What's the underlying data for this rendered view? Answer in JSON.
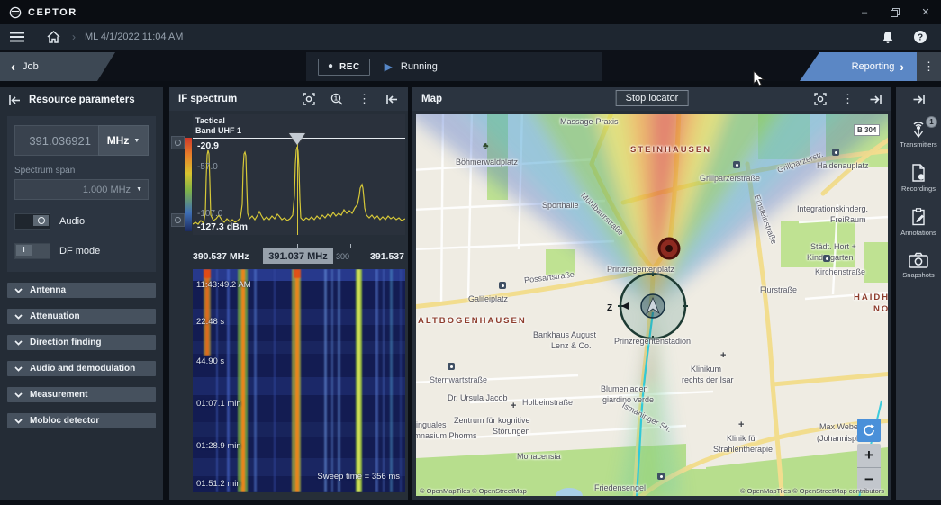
{
  "window": {
    "brand": "CEPTOR"
  },
  "icons": {
    "kebab": "⋮",
    "chevron_left": "‹",
    "chevron_right": "›",
    "breadcrumb_sep": "›",
    "dropdown": "▼",
    "rec_dot": "●",
    "play": "▶",
    "minimize": "–",
    "close": "✕",
    "help": "?",
    "df_knob": "I",
    "zoom_in": "+",
    "zoom_out": "−",
    "tree": "♣",
    "cross": "+"
  },
  "nav": {
    "breadcrumb": "ML 4/1/2022 11:04 AM"
  },
  "tabbar": {
    "job": "Job",
    "rec": "REC",
    "running": "Running",
    "reporting": "Reporting"
  },
  "resource": {
    "title": "Resource parameters",
    "frequency_value": "391.036921",
    "frequency_unit": "MHz",
    "span_label": "Spectrum span",
    "span_value": "1.000 MHz",
    "audio_label": "Audio",
    "df_label": "DF mode",
    "sections": [
      {
        "label": "Antenna"
      },
      {
        "label": "Attenuation"
      },
      {
        "label": "Direction finding"
      },
      {
        "label": "Audio and demodulation"
      },
      {
        "label": "Measurement"
      },
      {
        "label": "Mobloc detector"
      }
    ]
  },
  "spectrum": {
    "title": "IF spectrum",
    "band_line1": "Tactical",
    "band_line2": "Band UHF 1",
    "y0": "-20.9",
    "y1": "-57.0",
    "y2": "-107.0",
    "y3": "-127.3 dBm",
    "f_left": "390.537 MHz",
    "f_center": "391.037 MHz",
    "f_partial": "300",
    "f_right": "391.537",
    "times": [
      "11:43:49.2 AM",
      "22.48 s",
      "44.90 s",
      "01:07.1 min",
      "01:28.9 min",
      "01:51.2 min"
    ],
    "sweep": "Sweep time = 356 ms"
  },
  "map": {
    "title": "Map",
    "stop_locator": "Stop locator",
    "compass": "Z",
    "attribution_left": "© OpenMapTiles  © OpenStreetMap",
    "attribution_right": "© OpenMapTiles © OpenStreetMap contributors",
    "labels": {
      "massage": "Massage-Praxis",
      "steinhausen": "STEINHAUSEN",
      "boehmerwaldplatz": "Böhmerwaldplatz",
      "b304": "B 304",
      "haidenauplatz": "Haidenauplatz",
      "grillparzerstrasse": "Grillparzerstraße",
      "grillparzerstr": "Grillparzerstr.",
      "einsteinstrasse": "Einsteinstraße",
      "muehlbaurstrasse": "Mühlbaurstraße",
      "sporthalle": "Sporthalle",
      "integrations1": "Integrationskinderg.",
      "integrations2": "FreiRaum",
      "hort1": "Städt. Hort +",
      "hort2": "Kindergarten",
      "kirchenstrasse": "Kirchenstraße",
      "haidhausen1": "HAIDHAUSEN",
      "haidhausen2": "NORD",
      "flurstrasse": "Flurstraße",
      "prinzregentenplatz": "Prinzregentenplatz",
      "altbogenhausen": "ALTBOGENHAUSEN",
      "bankhaus1": "Bankhaus August",
      "bankhaus2": "Lenz & Co.",
      "sternwartstrasse": "Sternwartstraße",
      "ursula": "Dr. Ursula Jacob",
      "holbeinstrasse": "Holbeinstraße",
      "possartstrasse": "Possartstraße",
      "galileiplatz": "Galileiplatz",
      "prinzregentenstadion": "Prinzregentenstadion",
      "blumenladen1": "Blumenladen",
      "blumenladen2": "giardino verde",
      "klinikum1": "Klinikum",
      "klinikum2": "rechts der Isar",
      "zentrum1": "Zentrum für kognitive",
      "zentrum2": "Störungen",
      "monacensia": "Monacensia",
      "bilinguales1": "Bilinguales",
      "bilinguales2": "Gymnasium Phorms",
      "friedensengel": "Friedensengel",
      "maxweber1": "Max Weber",
      "maxweber2": "(Johannispl.",
      "klinik1": "Klinik für",
      "klinik2": "Strahlentherapie",
      "ismaninger": "Ismaninger Str."
    }
  },
  "sidebar": {
    "items": [
      {
        "label": "Transmitters",
        "badge": "1"
      },
      {
        "label": "Recordings"
      },
      {
        "label": "Annotations"
      },
      {
        "label": "Snapshots"
      }
    ]
  }
}
